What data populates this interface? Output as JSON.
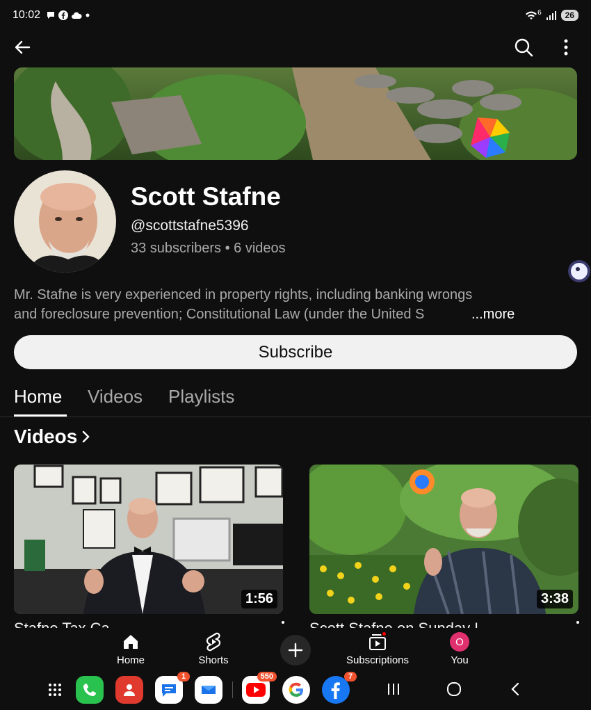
{
  "status_bar": {
    "time": "10:02",
    "notification_icons": [
      "chat-bubble-icon",
      "facebook-icon",
      "cloud-icon",
      "dot-icon"
    ],
    "signal_icons": [
      "wifi-icon",
      "cellular-signal-icon"
    ],
    "wifi_label": "6",
    "battery": "26"
  },
  "top_bar": {
    "icons": [
      "back-arrow-icon",
      "search-icon",
      "more-vert-icon"
    ]
  },
  "channel": {
    "name": "Scott Stafne",
    "handle": "@scottstafne5396",
    "meta": "33 subscribers • 6 videos",
    "description_line1": "Mr. Stafne is very experienced in property rights, including banking wrongs",
    "description_line2": "and foreclosure prevention; Constitutional Law (under the United S",
    "more_label": "...more",
    "subscribe_label": "Subscribe"
  },
  "tabs": [
    {
      "label": "Home",
      "active": true
    },
    {
      "label": "Videos",
      "active": false
    },
    {
      "label": "Playlists",
      "active": false
    }
  ],
  "section": {
    "title": "Videos"
  },
  "videos": [
    {
      "duration": "1:56",
      "title_peek": "Stafne Tax Ca..."
    },
    {
      "duration": "3:38",
      "title_peek": "Scott Stafne on Sunday L..."
    }
  ],
  "bottom_nav": {
    "items": [
      {
        "label": "Home",
        "icon": "home-icon"
      },
      {
        "label": "Shorts",
        "icon": "shorts-icon"
      },
      {
        "label": "Subscriptions",
        "icon": "subscriptions-icon"
      },
      {
        "label": "You",
        "icon": "avatar"
      }
    ],
    "you_initial": "O"
  },
  "dock": {
    "apps": [
      {
        "name": "apps-grid-icon",
        "badge": ""
      },
      {
        "name": "phone-icon",
        "badge": ""
      },
      {
        "name": "contacts-icon",
        "badge": ""
      },
      {
        "name": "messages-icon",
        "badge": "1"
      },
      {
        "name": "mail-icon",
        "badge": ""
      },
      {
        "name": "youtube-icon",
        "badge": "550"
      },
      {
        "name": "google-icon",
        "badge": ""
      },
      {
        "name": "facebook-icon",
        "badge": "7"
      }
    ],
    "system_nav": [
      "recents-icon",
      "home-circle-icon",
      "back-chevron-icon"
    ]
  },
  "colors": {
    "background": "#0f0f0f",
    "text_primary": "#f1f1f1",
    "text_secondary": "#aaaaaa",
    "badge": "#f0522e",
    "you_avatar": "#e0306e",
    "phone_app": "#29c24f",
    "contacts_app": "#e03a2f",
    "youtube_red": "#ff0000",
    "facebook_blue": "#1877f2"
  }
}
